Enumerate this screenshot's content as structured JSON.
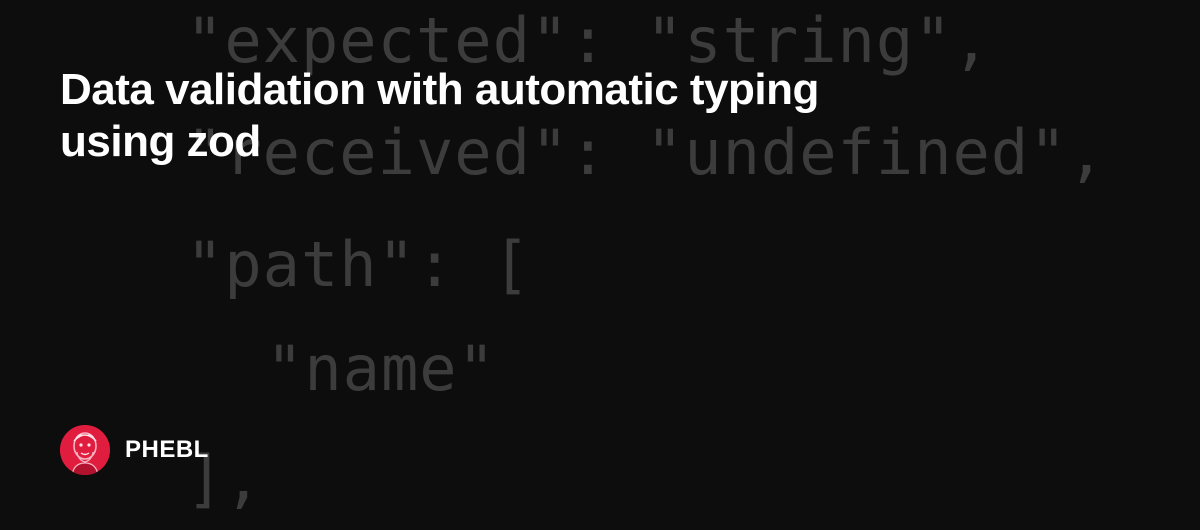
{
  "background_code": [
    "\"expected\": \"string\",",
    "\"received\": \"undefined\",",
    "\"path\": [",
    "\"name\"",
    "],"
  ],
  "title": "Data validation with automatic typing using zod",
  "author": {
    "name": "PHEBL",
    "avatar_icon": "avatar-portrait-icon",
    "avatar_color": "#e11d3f"
  },
  "colors": {
    "background": "#0d0d0d",
    "code_text": "#3c3c3c",
    "title_text": "#ffffff"
  }
}
